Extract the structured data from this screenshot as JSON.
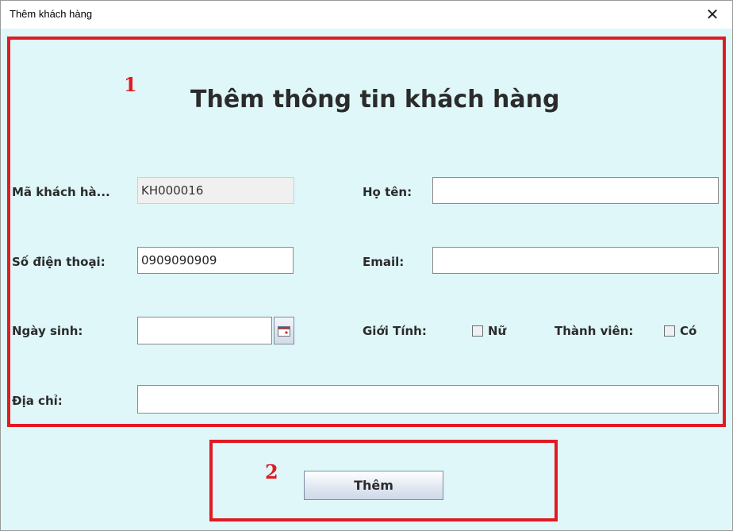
{
  "window": {
    "title": "Thêm khách hàng",
    "close_glyph": "✕"
  },
  "annotations": {
    "box1": "1",
    "box2": "2",
    "color": "#e01b24"
  },
  "form": {
    "heading": "Thêm thông tin khách hàng",
    "ma_kh_label": "Mã khách hà...",
    "ma_kh_value": "KH000016",
    "ho_ten_label": "Họ tên:",
    "ho_ten_value": "",
    "sdt_label": "Số điện thoại:",
    "sdt_value": "0909090909",
    "email_label": "Email:",
    "email_value": "",
    "ngay_sinh_label": "Ngày sinh:",
    "ngay_sinh_value": "",
    "gioi_tinh_label": "Giới Tính:",
    "nu_label": "Nữ",
    "nu_checked": false,
    "thanh_vien_label": "Thành viên:",
    "co_label": "Có",
    "co_checked": false,
    "dia_chi_label": "Địa chỉ:",
    "dia_chi_value": ""
  },
  "actions": {
    "submit_label": "Thêm"
  },
  "colors": {
    "background": "#dff7f8",
    "annotation_border": "#e01b24"
  }
}
